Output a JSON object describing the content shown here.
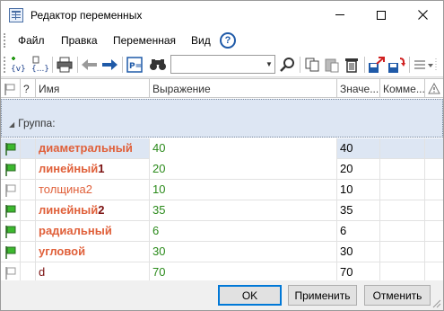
{
  "window": {
    "title": "Редактор переменных"
  },
  "menu": {
    "items": [
      "Файл",
      "Правка",
      "Переменная",
      "Вид"
    ]
  },
  "toolbar": {
    "search_value": ""
  },
  "grid": {
    "columns": {
      "flag": "",
      "q": "?",
      "name": "Имя",
      "expr": "Выражение",
      "value": "Значе...",
      "comment": "Комме..."
    },
    "group_label": "Группа:",
    "rows": [
      {
        "name": "диаметральный",
        "suffix": "",
        "style": "bold",
        "expr": "40",
        "value": "40",
        "flag": "green",
        "selected": true
      },
      {
        "name": "линейный",
        "suffix": "1",
        "style": "bold",
        "expr": "20",
        "value": "20",
        "flag": "green",
        "selected": false
      },
      {
        "name": "толщина",
        "suffix": "2",
        "style": "plain",
        "expr": "10",
        "value": "10",
        "flag": "gray",
        "selected": false
      },
      {
        "name": "линейный",
        "suffix": "2",
        "style": "bold",
        "expr": "35",
        "value": "35",
        "flag": "green",
        "selected": false
      },
      {
        "name": "радиальный",
        "suffix": "",
        "style": "bold",
        "expr": "6",
        "value": "6",
        "flag": "green",
        "selected": false
      },
      {
        "name": "угловой",
        "suffix": "",
        "style": "bold",
        "expr": "30",
        "value": "30",
        "flag": "green",
        "selected": false
      },
      {
        "name": "d",
        "suffix": "",
        "style": "dark",
        "expr": "70",
        "value": "70",
        "flag": "gray",
        "selected": false
      }
    ]
  },
  "footer": {
    "ok": "OK",
    "apply": "Применить",
    "cancel": "Отменить"
  },
  "colors": {
    "accent": "#0078d7",
    "name_orange": "#e0603a",
    "name_dark": "#7a1010",
    "expr_green": "#2a8a1a",
    "selection": "#dde6f3",
    "flag_green": "#3cb82e"
  }
}
